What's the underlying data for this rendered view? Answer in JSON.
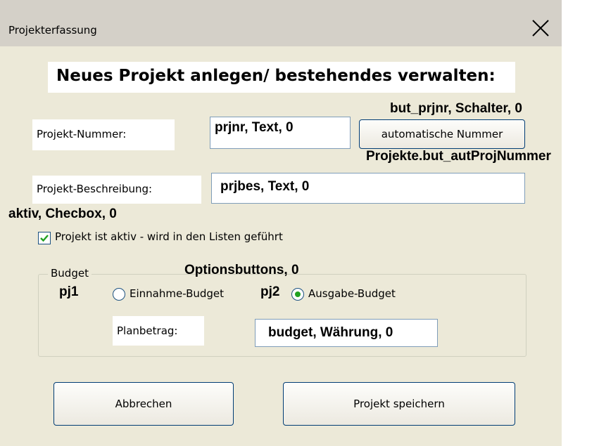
{
  "window": {
    "title": "Projekterfassung",
    "close_glyph": "✕"
  },
  "heading": "Neues Projekt anlegen/ bestehendes verwalten:",
  "project_number": {
    "label": "Projekt-Nummer:",
    "textbox_value": "prjnr, Text, 0",
    "button_label": "automatische Nummer",
    "button_annotation": "but_prjnr, Schalter, 0",
    "button_macro": "Projekte.but_autProjNummer"
  },
  "project_description": {
    "label": "Projekt-Beschreibung:",
    "textbox_value": "prjbes, Text, 0"
  },
  "active": {
    "annotation": "aktiv, Checbox, 0",
    "checked": true,
    "label": "Projekt ist aktiv - wird in den Listen geführt"
  },
  "budget": {
    "group_label": "Budget",
    "options_annotation": "Optionsbuttons, 0",
    "option1_annotation": "pj1",
    "option1_label": "Einnahme-Budget",
    "option1_selected": false,
    "option2_annotation": "pj2",
    "option2_label": "Ausgabe-Budget",
    "option2_selected": true,
    "amount_label": "Planbetrag:",
    "amount_value": "budget, Währung, 0"
  },
  "buttons": {
    "cancel": "Abbrechen",
    "save": "Projekt speichern"
  },
  "colors": {
    "dialog_bg": "#ece9d8",
    "titlebar_bg": "#d4d0c8",
    "check_green": "#21a121"
  }
}
